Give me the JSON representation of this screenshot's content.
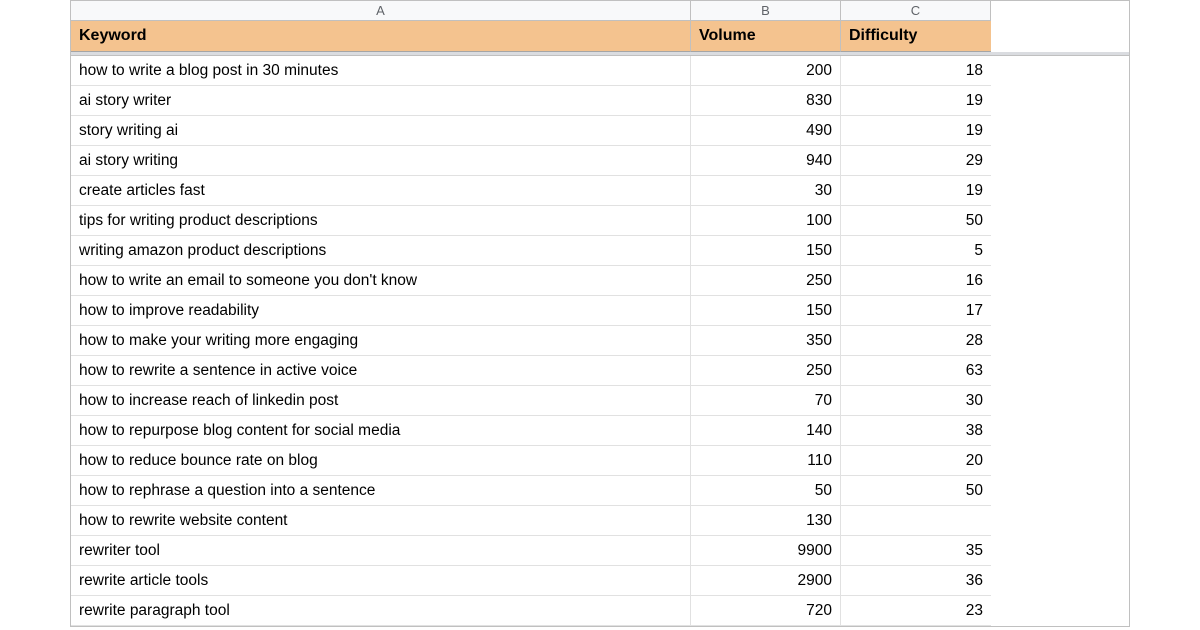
{
  "columns": [
    "A",
    "B",
    "C"
  ],
  "headers": {
    "keyword": "Keyword",
    "volume": "Volume",
    "difficulty": "Difficulty"
  },
  "rows": [
    {
      "keyword": "how to write a blog post in 30 minutes",
      "volume": "200",
      "difficulty": "18"
    },
    {
      "keyword": "ai story writer",
      "volume": "830",
      "difficulty": "19"
    },
    {
      "keyword": "story writing ai",
      "volume": "490",
      "difficulty": "19"
    },
    {
      "keyword": "ai story writing",
      "volume": "940",
      "difficulty": "29"
    },
    {
      "keyword": "create articles fast",
      "volume": "30",
      "difficulty": "19"
    },
    {
      "keyword": "tips for writing product descriptions",
      "volume": "100",
      "difficulty": "50"
    },
    {
      "keyword": "writing amazon product descriptions",
      "volume": "150",
      "difficulty": "5"
    },
    {
      "keyword": "how to write an email to someone you don't know",
      "volume": "250",
      "difficulty": "16"
    },
    {
      "keyword": "how to improve readability",
      "volume": "150",
      "difficulty": "17"
    },
    {
      "keyword": "how to make your writing more engaging",
      "volume": "350",
      "difficulty": "28"
    },
    {
      "keyword": "how to rewrite a sentence in active voice",
      "volume": "250",
      "difficulty": "63"
    },
    {
      "keyword": "how to increase reach of linkedin post",
      "volume": "70",
      "difficulty": "30"
    },
    {
      "keyword": "how to repurpose blog content for social media",
      "volume": "140",
      "difficulty": "38"
    },
    {
      "keyword": "how to reduce bounce rate on blog",
      "volume": "110",
      "difficulty": "20"
    },
    {
      "keyword": "how to rephrase a question into a sentence",
      "volume": "50",
      "difficulty": "50"
    },
    {
      "keyword": "how to rewrite website content",
      "volume": "130",
      "difficulty": ""
    },
    {
      "keyword": "rewriter tool",
      "volume": "9900",
      "difficulty": "35"
    },
    {
      "keyword": "rewrite article tools",
      "volume": "2900",
      "difficulty": "36"
    },
    {
      "keyword": "rewrite paragraph tool",
      "volume": "720",
      "difficulty": "23"
    }
  ]
}
